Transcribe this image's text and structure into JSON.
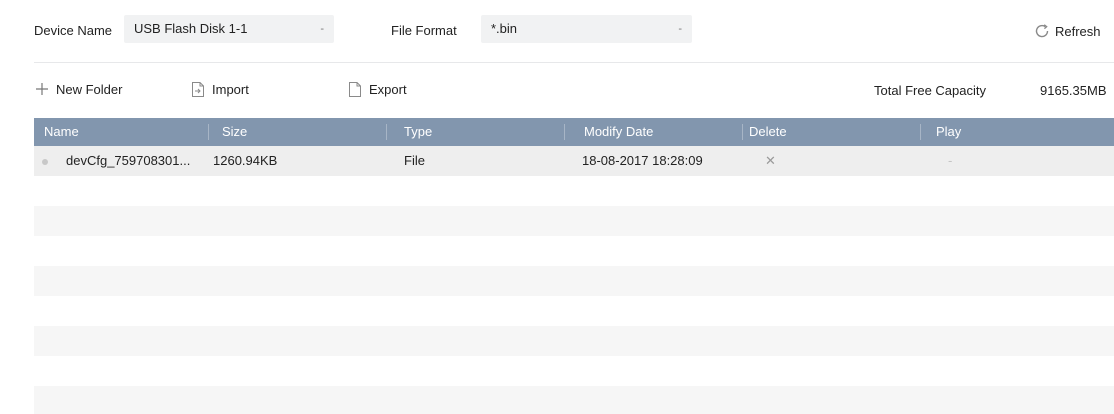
{
  "filters": {
    "device_name_label": "Device Name",
    "device_name_value": "USB Flash Disk 1-1",
    "file_format_label": "File Format",
    "file_format_value": "*.bin",
    "refresh_label": "Refresh",
    "dropdown_caret": "-"
  },
  "toolbar": {
    "new_folder_label": "New Folder",
    "import_label": "Import",
    "export_label": "Export",
    "capacity_label": "Total Free Capacity",
    "capacity_value": "9165.35MB"
  },
  "table": {
    "columns": [
      "Name",
      "Size",
      "Type",
      "Modify Date",
      "Delete",
      "Play"
    ],
    "rows": [
      {
        "name": "devCfg_759708301...",
        "size": "1260.94KB",
        "type": "File",
        "modify_date": "18-08-2017 18:28:09",
        "delete_icon": "close-icon",
        "play": "-"
      }
    ]
  },
  "colors": {
    "header_bg": "#8296ae",
    "header_text": "#ffffff",
    "selected_row_bg": "#eeeeee",
    "alt_row_bg": "#f6f6f6",
    "select_bg": "#f1f2f3"
  }
}
